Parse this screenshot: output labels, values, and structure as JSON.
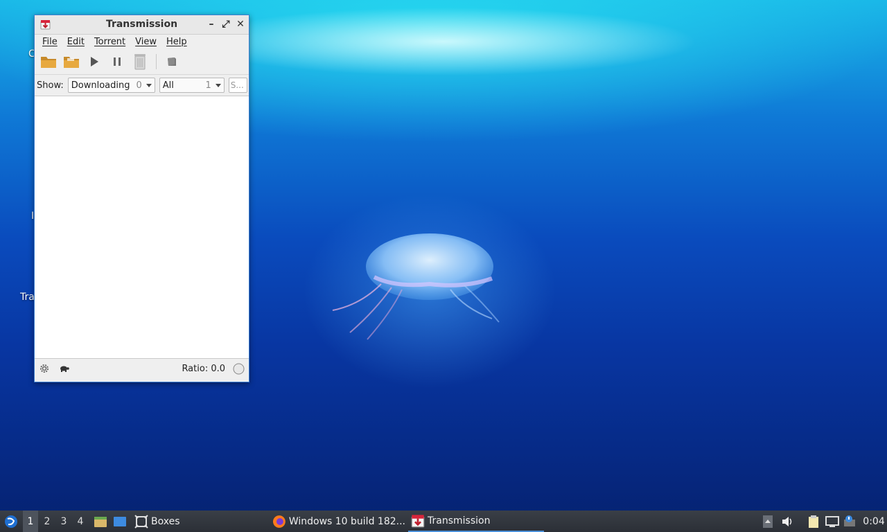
{
  "desktop": {
    "fragments": [
      "C",
      "I",
      "Tra"
    ]
  },
  "window": {
    "title": "Transmission",
    "menu": [
      "File",
      "Edit",
      "Torrent",
      "View",
      "Help"
    ],
    "toolbar_icons": [
      "open-folder-icon",
      "open-url-folder-icon",
      "start-icon",
      "pause-icon",
      "remove-icon",
      "properties-icon"
    ],
    "filter": {
      "show_label": "Show:",
      "activity": {
        "value": "Downloading",
        "count": "0"
      },
      "tracker": {
        "value": "All",
        "count": "1"
      },
      "search_placeholder": "S..."
    },
    "status": {
      "ratio": "Ratio: 0.0"
    }
  },
  "taskbar": {
    "workspaces": [
      "1",
      "2",
      "3",
      "4"
    ],
    "active_workspace": "1",
    "launchers": [
      "file-manager-icon",
      "desktop-icon"
    ],
    "tasks": [
      {
        "label": "Boxes"
      },
      {
        "label": "Windows 10 build 182..."
      },
      {
        "label": "Transmission"
      }
    ],
    "clock": "0:04"
  },
  "colors": {
    "window_border": "#3d7fd1",
    "taskbar": "#2f333a",
    "active_task_underline": "#4a90d9"
  }
}
